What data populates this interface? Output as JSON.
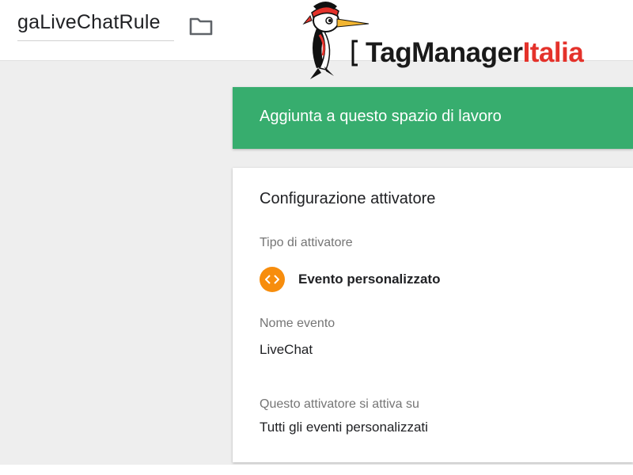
{
  "header": {
    "title": "gaLiveChatRule",
    "folder_icon": "folder-icon"
  },
  "brand": {
    "name_part1": "TagManager",
    "name_part2": "Italia",
    "accent_color": "#e4322b"
  },
  "banner": {
    "text": "Aggiunta a questo spazio di lavoro",
    "color": "#37ad6e"
  },
  "config": {
    "title": "Configurazione attivatore",
    "trigger_type_label": "Tipo di attivatore",
    "trigger_type_value": "Evento personalizzato",
    "trigger_icon": "code-brackets-icon",
    "trigger_icon_color": "#f78d0d",
    "event_name_label": "Nome evento",
    "event_name_value": "LiveChat",
    "fires_on_label": "Questo attivatore si attiva su",
    "fires_on_value": "Tutti gli eventi personalizzati"
  }
}
